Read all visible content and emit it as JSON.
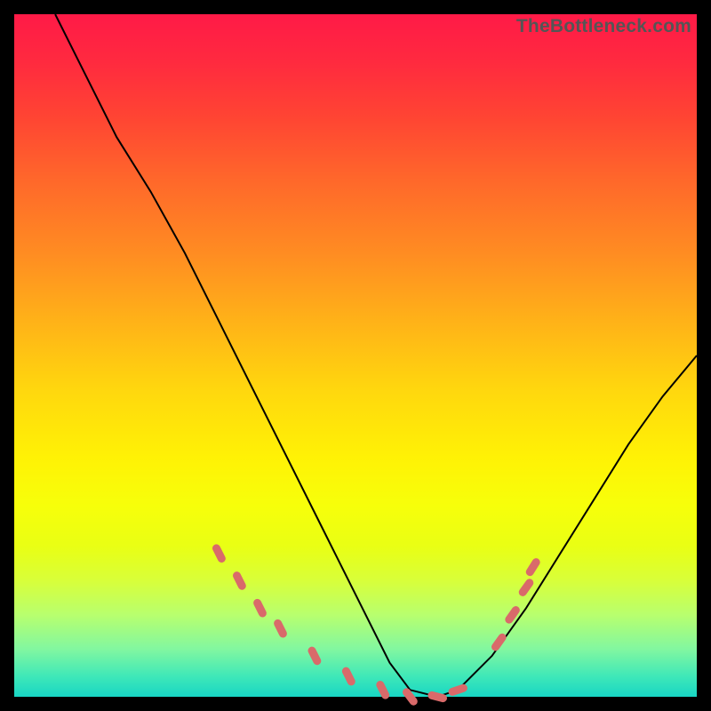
{
  "watermark": "TheBottleneck.com",
  "colors": {
    "frame_bg": "#000000",
    "gradient_top": "#ff1a47",
    "gradient_bottom": "#18d6c4",
    "curve": "#000000",
    "marker": "#d96a6a"
  },
  "chart_data": {
    "type": "line",
    "title": "",
    "xlabel": "",
    "ylabel": "",
    "xlim": [
      0,
      100
    ],
    "ylim": [
      0,
      100
    ],
    "description": "V-shaped bottleneck curve over a vertical rainbow heat gradient. Left branch starts near top-left and descends steeply; floor near zero around x≈55–65; right branch rises with gentler slope ending around y≈50 at right edge. Salmon-colored dashed marker segments overlay the curve near the bottom of each branch and along the floor.",
    "series": [
      {
        "name": "bottleneck-curve",
        "x": [
          6,
          10,
          15,
          20,
          25,
          30,
          35,
          40,
          45,
          50,
          55,
          58,
          62,
          65,
          70,
          75,
          80,
          85,
          90,
          95,
          100
        ],
        "y": [
          100,
          92,
          82,
          74,
          65,
          55,
          45,
          35,
          25,
          15,
          5,
          1,
          0,
          1,
          6,
          13,
          21,
          29,
          37,
          44,
          50
        ]
      }
    ],
    "markers": {
      "note": "Rounded salmon dash segments overlaid on the curve near the valley.",
      "segments": [
        {
          "x": 30,
          "y": 21
        },
        {
          "x": 33,
          "y": 17
        },
        {
          "x": 36,
          "y": 13
        },
        {
          "x": 39,
          "y": 10
        },
        {
          "x": 44,
          "y": 6
        },
        {
          "x": 49,
          "y": 3
        },
        {
          "x": 54,
          "y": 1
        },
        {
          "x": 58,
          "y": 0
        },
        {
          "x": 62,
          "y": 0
        },
        {
          "x": 65,
          "y": 1
        },
        {
          "x": 71,
          "y": 8
        },
        {
          "x": 73,
          "y": 12
        },
        {
          "x": 75,
          "y": 16
        },
        {
          "x": 76,
          "y": 19
        }
      ]
    }
  }
}
